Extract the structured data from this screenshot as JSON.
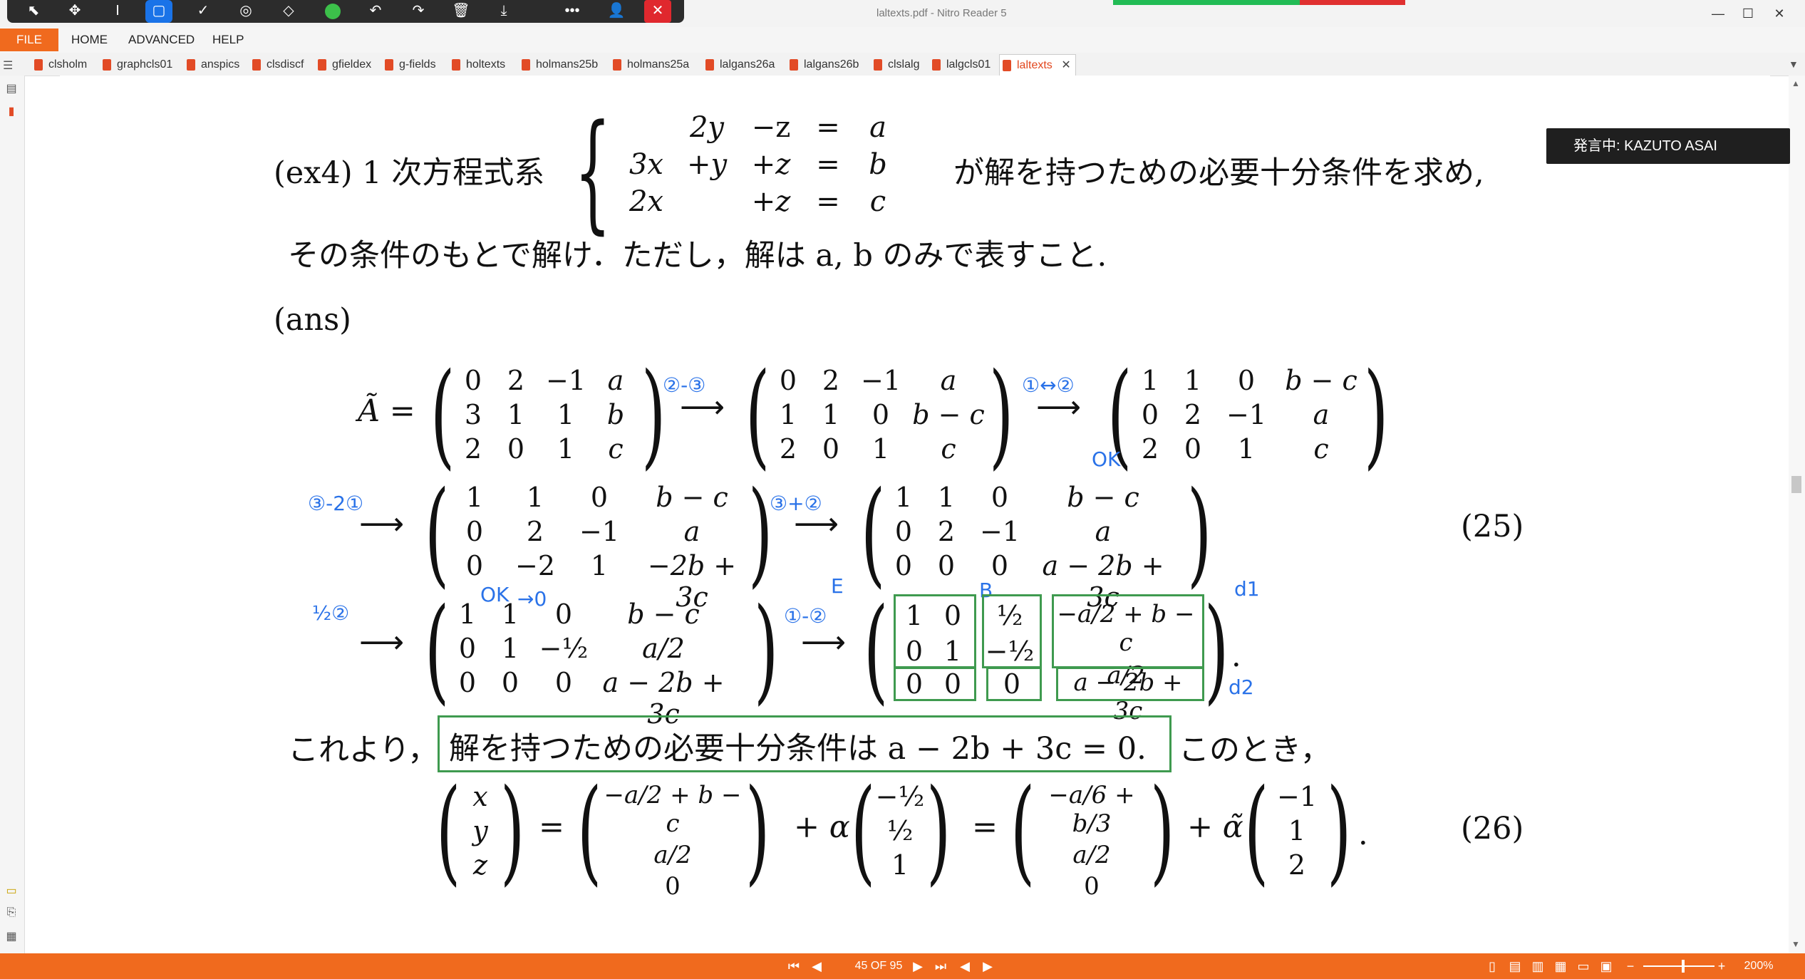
{
  "window": {
    "title": "laltexts.pdf - Nitro Reader 5"
  },
  "toolbar": {
    "icons": [
      "pointer-icon",
      "move-icon",
      "text-cursor-icon",
      "rectangle-icon",
      "check-icon",
      "stamp-icon",
      "eraser-icon",
      "green-dot-icon",
      "undo-icon",
      "redo-icon",
      "delete-icon",
      "download-icon",
      "more-icon",
      "user-icon",
      "close-icon"
    ],
    "accent": "#1a73e8"
  },
  "menu": {
    "file": "FILE",
    "home": "HOME",
    "advanced": "ADVANCED",
    "help": "HELP"
  },
  "tabs": [
    "clsholm",
    "graphcls01",
    "anspics",
    "clsdiscf",
    "gfieldex",
    "g-fields",
    "holtexts",
    "holmans25b",
    "holmans25a",
    "lalgans26a",
    "lalgans26b",
    "clslalg",
    "lalgcls01",
    "laltexts"
  ],
  "active_tab": "laltexts",
  "speaker": "発言中: KAZUTO ASAI",
  "status": {
    "page": "45 OF 95",
    "zoom": "200%"
  },
  "brand_color": "#f06a1e",
  "document": {
    "problem_prefix": "(ex4)  1 次方程式系",
    "problem_suffix": "が解を持つための必要十分条件を求め,",
    "problem_line2": "その条件のもとで解け．ただし，解は a, b のみで表すこと.",
    "system": [
      [
        "2y",
        "−z",
        "=",
        "a"
      ],
      [
        "3x",
        "+y",
        "+z",
        "=",
        "b"
      ],
      [
        "2x",
        "+z",
        "=",
        "c"
      ]
    ],
    "ans": "(ans)",
    "a_tilde": "Ã =",
    "m1": [
      "0",
      "2",
      "−1",
      "a",
      "3",
      "1",
      "1",
      "b",
      "2",
      "0",
      "1",
      "c"
    ],
    "m2": [
      "0",
      "2",
      "−1",
      "a",
      "1",
      "1",
      "0",
      "b − c",
      "2",
      "0",
      "1",
      "c"
    ],
    "m3": [
      "1",
      "1",
      "0",
      "b − c",
      "0",
      "2",
      "−1",
      "a",
      "2",
      "0",
      "1",
      "c"
    ],
    "m4": [
      "1",
      "1",
      "0",
      "b − c",
      "0",
      "2",
      "−1",
      "a",
      "0",
      "−2",
      "1",
      "−2b + 3c"
    ],
    "m5": [
      "1",
      "1",
      "0",
      "b − c",
      "0",
      "2",
      "−1",
      "a",
      "0",
      "0",
      "0",
      "a − 2b + 3c"
    ],
    "m6": [
      "1",
      "1",
      "0",
      "b − c",
      "0",
      "1",
      "−½",
      "a/2",
      "0",
      "0",
      "0",
      "a − 2b + 3c"
    ],
    "m7_left": [
      "1",
      "0",
      "0",
      "1",
      "0",
      "0"
    ],
    "m7_b": [
      "½",
      "−½",
      "0"
    ],
    "m7_d": [
      "−a/2 + b − c",
      "a/2",
      "a − 2b + 3c"
    ],
    "eq25": "(25)",
    "eq26": "(26)",
    "conclusion_pre": "これより，",
    "conclusion_box": "解を持つための必要十分条件は a − 2b + 3c = 0.",
    "conclusion_post": "このとき，",
    "vec_xyz": [
      "x",
      "y",
      "z"
    ],
    "vec_1": [
      "−a/2 + b − c",
      "a/2",
      "0"
    ],
    "vec_2": [
      "−½",
      "½",
      "1"
    ],
    "vec_3": [
      "−a/6 + b/3",
      "a/2",
      "0"
    ],
    "vec_4": [
      "−1",
      "1",
      "2"
    ],
    "plus_alpha": "+ α",
    "plus_alpha_tilde": "+ α̃",
    "equals": "=",
    "handwritten": {
      "op1": "②-③",
      "op2": "①↔②",
      "op3": "③-2①",
      "op4": "③+②",
      "op5": "½②",
      "op6": "①-②",
      "ok1": "OK",
      "ok2": "OK",
      "ok3": "→0",
      "label_e": "E",
      "label_b": "B",
      "label_d1": "d1",
      "label_d2": "d2"
    }
  }
}
